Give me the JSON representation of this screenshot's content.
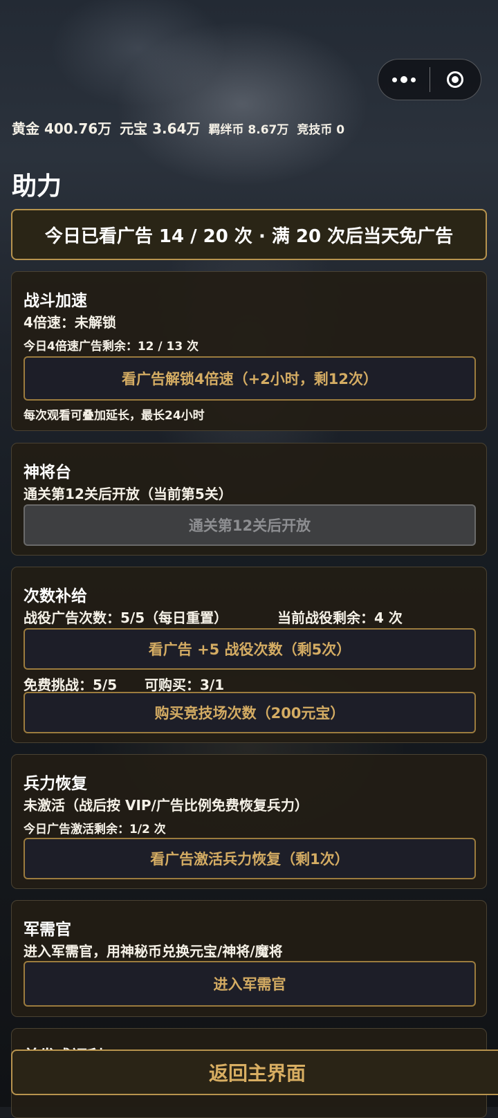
{
  "capsule": {
    "more_icon": "more-dots-icon",
    "close_icon": "target-circle-icon"
  },
  "currency": {
    "gold_label": "黄金",
    "gold_value": "400.76万",
    "yuanbao_label": "元宝",
    "yuanbao_value": "3.64万",
    "bond_label": "羁绊币",
    "bond_value": "8.67万",
    "arena_label": "竞技币",
    "arena_value": "0"
  },
  "page": {
    "title": "助力"
  },
  "ad_banner": {
    "text": "今日已看广告 14 / 20 次 · 满 20 次后当天免广告"
  },
  "battle_speed": {
    "title": "战斗加速",
    "status": "4倍速：未解锁",
    "remaining": "今日4倍速广告剩余：12 / 13 次",
    "button": "看广告解锁4倍速（+2小时，剩12次）",
    "note": "每次观看可叠加延长，最长24小时"
  },
  "general_stage": {
    "title": "神将台",
    "status": "通关第12关后开放（当前第5关）",
    "button": "通关第12关后开放"
  },
  "count_supply": {
    "title": "次数补给",
    "campaign_ads": "战役广告次数：5/5（每日重置）",
    "campaign_remaining": "当前战役剩余：4 次",
    "ad_button": "看广告 +5 战役次数（剩5次）",
    "free_challenge": "免费挑战：5/5",
    "purchasable": "可购买：3/1",
    "buy_button": "购买竞技场次数（200元宝）"
  },
  "troop_recovery": {
    "title": "兵力恢复",
    "status": "未激活（战后按 VIP/广告比例免费恢复兵力）",
    "remaining": "今日广告激活剩余：1/2 次",
    "button": "看广告激活兵力恢复（剩1次）"
  },
  "quartermaster": {
    "title": "军需官",
    "desc": "进入军需官，用神秘币兑换元宝/神将/魔将",
    "button": "进入军需官"
  },
  "partial_card": {
    "title": "首发成福利"
  },
  "bottom": {
    "back_button": "返回主界面"
  }
}
